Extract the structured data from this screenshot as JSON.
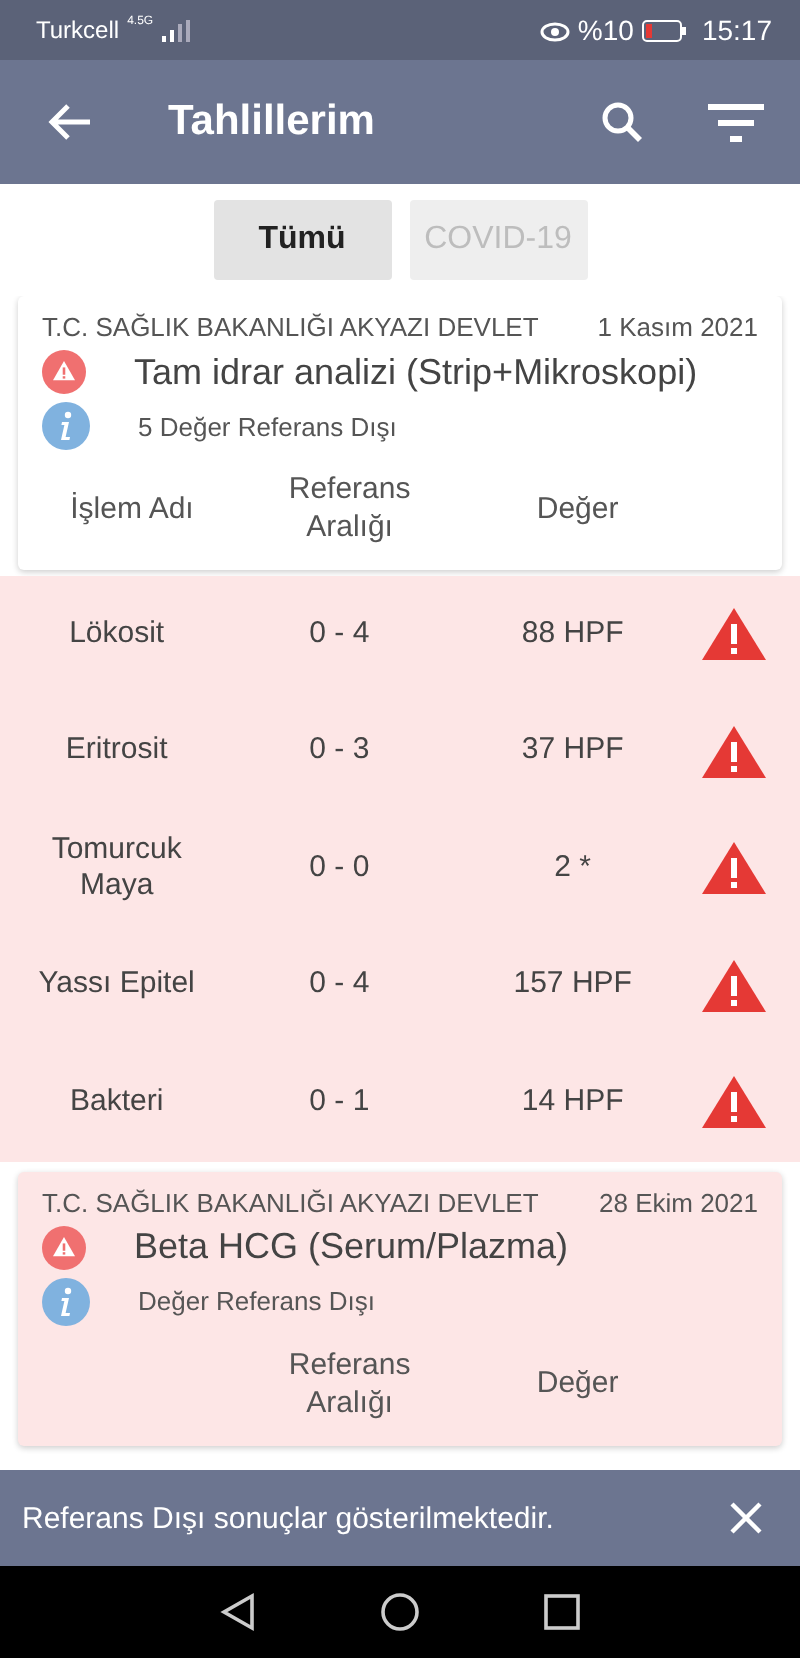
{
  "status_bar": {
    "carrier": "Turkcell",
    "network": "4.5G",
    "battery": "%10",
    "time": "15:17"
  },
  "app_bar": {
    "title": "Tahlillerim"
  },
  "tabs": [
    {
      "label": "Tümü",
      "selected": true
    },
    {
      "label": "COVID-19",
      "selected": false
    }
  ],
  "results": [
    {
      "institution": "T.C. SAĞLIK BAKANLIĞI AKYAZI DEVLET",
      "date": "1 Kasım 2021",
      "test": "Tam idrar analizi (Strip+Mikroskopi)",
      "summary": "5 Değer Referans Dışı",
      "highlighted": false,
      "columns": [
        "İşlem Adı",
        "Referans\nAralığı",
        "Değer"
      ],
      "rows": [
        {
          "name": "Lökosit",
          "range": "0 - 4",
          "value": "88 HPF",
          "out_of_range": true
        },
        {
          "name": "Eritrosit",
          "range": "0 - 3",
          "value": "37 HPF",
          "out_of_range": true
        },
        {
          "name": "Tomurcuk\nMaya",
          "range": "0 - 0",
          "value": "2 *",
          "out_of_range": true
        },
        {
          "name": "Yassı Epitel",
          "range": "0 - 4",
          "value": "157 HPF",
          "out_of_range": true
        },
        {
          "name": "Bakteri",
          "range": "0 - 1",
          "value": "14 HPF",
          "out_of_range": true
        }
      ]
    },
    {
      "institution": "T.C. SAĞLIK BAKANLIĞI AKYAZI DEVLET",
      "date": "28 Ekim 2021",
      "test": "Beta HCG (Serum/Plazma)",
      "summary": "Değer Referans Dışı",
      "highlighted": true,
      "columns": [
        "",
        "Referans\nAralığı",
        "Değer"
      ]
    }
  ],
  "snackbar": {
    "message": "Referans Dışı sonuçlar gösterilmektedir."
  }
}
